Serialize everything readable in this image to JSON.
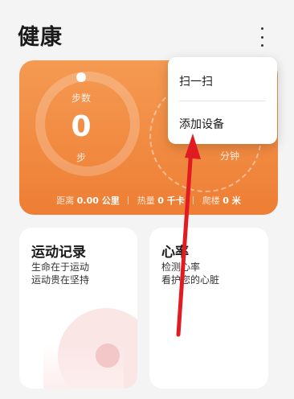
{
  "header": {
    "title": "健康"
  },
  "steps_card": {
    "steps_label": "步数",
    "steps_value": "0",
    "steps_unit": "步",
    "second_unit": "分钟",
    "distance_label": "距离",
    "distance_value": "0.00 公里",
    "calories_label": "热量",
    "calories_value": "0 千卡",
    "climb_label": "爬楼",
    "climb_value": "0 米"
  },
  "menu": {
    "items": [
      {
        "label": "扫一扫"
      },
      {
        "label": "添加设备"
      }
    ]
  },
  "tiles": [
    {
      "title": "运动记录",
      "line1": "生命在于运动",
      "line2": "运动贵在坚持"
    },
    {
      "title": "心率",
      "line1": "检测心率",
      "line2": "看护您的心脏"
    }
  ],
  "colors": {
    "card": "#ef8438",
    "arrow": "#e11b22",
    "accent": "#ee7e34"
  }
}
